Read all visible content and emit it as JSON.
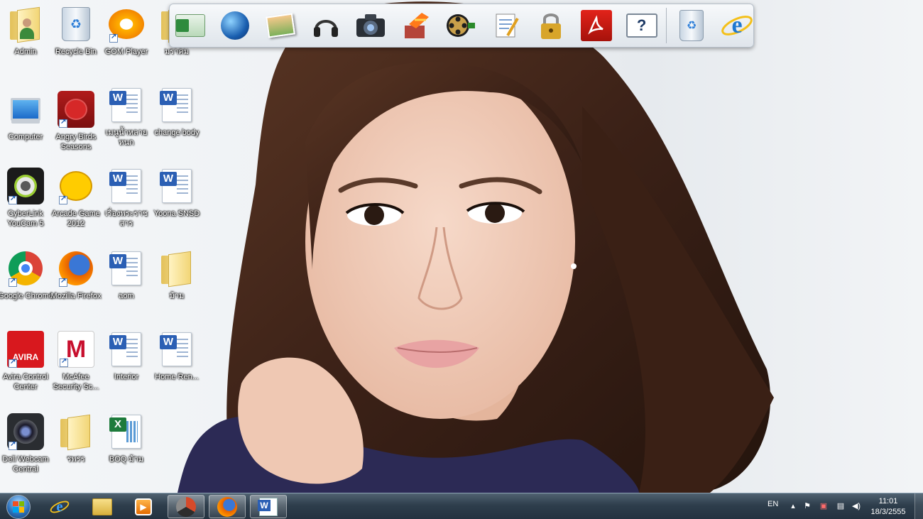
{
  "desktop": {
    "icons": [
      {
        "label": "Admin",
        "icon": "user-folder-icon"
      },
      {
        "label": "Recycle Bin",
        "icon": "recycle-bin-icon"
      },
      {
        "label": "GOM Player",
        "icon": "gom-player-icon"
      },
      {
        "label": "มราคม",
        "icon": "folder-icon"
      },
      {
        "label": "Computer",
        "icon": "computer-icon"
      },
      {
        "label": "Angry Birds Seasons",
        "icon": "angry-birds-icon"
      },
      {
        "label": "เมนูน้ำหลาย หนก",
        "icon": "word-doc-icon"
      },
      {
        "label": "change body",
        "icon": "word-doc-icon"
      },
      {
        "label": "CyberLink YouCam 5",
        "icon": "youcam-icon"
      },
      {
        "label": "Arcade Game 2012",
        "icon": "arcade-game-icon"
      },
      {
        "label": "เรื่องพระราชสาร",
        "icon": "word-doc-icon"
      },
      {
        "label": "Yoona SNSD",
        "icon": "word-doc-icon"
      },
      {
        "label": "Google Chrome",
        "icon": "chrome-icon"
      },
      {
        "label": "Mozilla Firefox",
        "icon": "firefox-icon"
      },
      {
        "label": "aom",
        "icon": "word-doc-icon"
      },
      {
        "label": "ม้าม",
        "icon": "folder-icon"
      },
      {
        "label": "Avira Control Center",
        "icon": "avira-icon"
      },
      {
        "label": "McAfee Security Sc...",
        "icon": "mcafee-icon"
      },
      {
        "label": "Interior",
        "icon": "word-doc-icon"
      },
      {
        "label": "Home Ren...",
        "icon": "word-doc-icon"
      },
      {
        "label": "Dell Webcam Central",
        "icon": "dell-webcam-icon"
      },
      {
        "label": "รพรร",
        "icon": "folder-icon"
      },
      {
        "label": "BOQ ม้าม",
        "icon": "excel-doc-icon"
      }
    ]
  },
  "dock": {
    "items": [
      "mail-icon",
      "globe-icon",
      "photo-album-icon",
      "headphones-icon",
      "camera-icon",
      "tools-icon",
      "film-reel-icon",
      "notepad-icon",
      "padlock-icon",
      "acrobat-icon",
      "help-icon",
      "recycle-bin-icon",
      "internet-explorer-icon"
    ]
  },
  "taskbar": {
    "pinned": [
      "internet-explorer-icon",
      "explorer-folder-icon",
      "media-player-icon",
      "gom-icon",
      "firefox-icon",
      "word-icon"
    ],
    "language": "EN",
    "time": "11:01",
    "date": "18/3/2555"
  },
  "colors": {
    "taskbar": "#2e3e4c",
    "word_blue": "#2b5fb4",
    "excel_green": "#1e7b3c"
  }
}
